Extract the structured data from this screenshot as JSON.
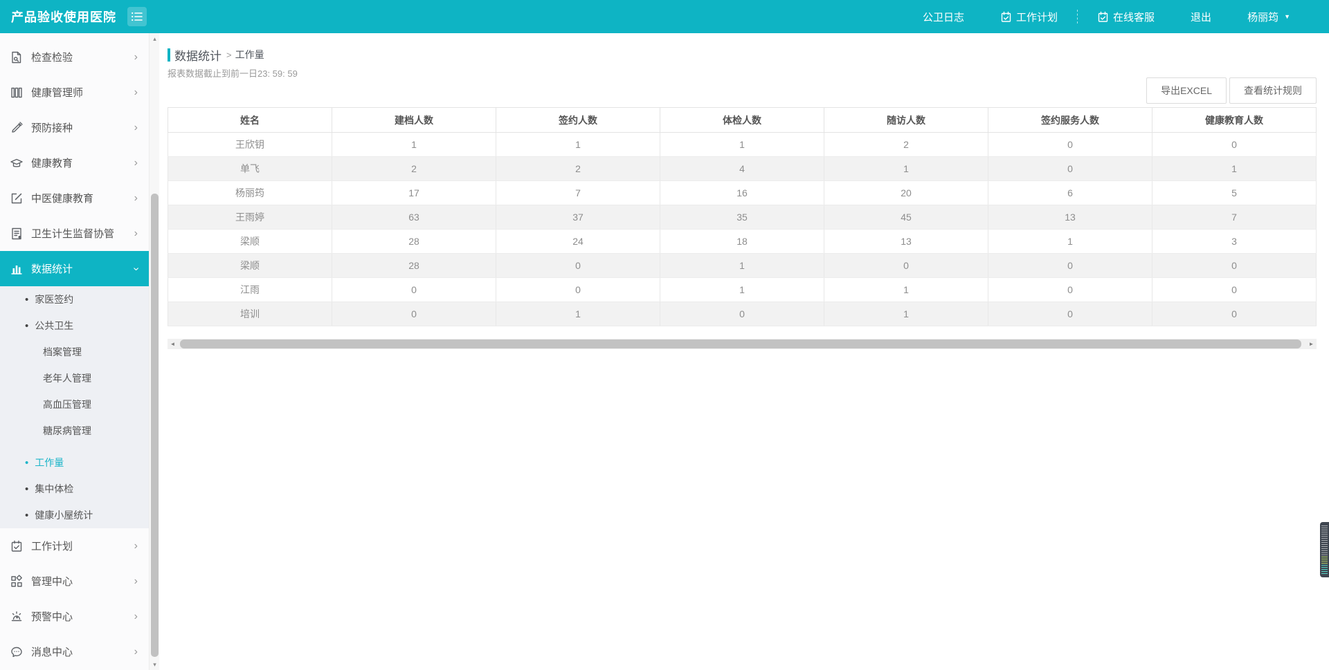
{
  "colors": {
    "accent": "#0eb4c4",
    "active_submenu_text": "#1cb5c9",
    "stripe_row": "#f2f2f2",
    "side_tab": "#3f4650"
  },
  "header": {
    "title": "产品验收使用医院",
    "menu_icon": "hamburger-list-icon",
    "nav": [
      {
        "label": "公卫日志"
      },
      {
        "label": "工作计划",
        "icon": "clipboard-check-icon"
      },
      {
        "divider": true
      },
      {
        "label": "在线客服",
        "icon": "clipboard-check-icon"
      },
      {
        "label": "退出"
      },
      {
        "label": "杨丽筠",
        "caret": "caret-down-icon"
      }
    ]
  },
  "sidebar": {
    "items": [
      {
        "type": "main",
        "label": "检查检验",
        "icon": "file-search-icon",
        "chevron": "right"
      },
      {
        "type": "main",
        "label": "健康管理师",
        "icon": "books-icon",
        "chevron": "right"
      },
      {
        "type": "main",
        "label": "预防接种",
        "icon": "syringe-icon",
        "chevron": "right"
      },
      {
        "type": "main",
        "label": "健康教育",
        "icon": "graduation-cap-icon",
        "chevron": "right"
      },
      {
        "type": "main",
        "label": "中医健康教育",
        "icon": "edit-square-icon",
        "chevron": "right"
      },
      {
        "type": "main",
        "label": "卫生计生监督协管",
        "icon": "report-doc-icon",
        "chevron": "right"
      },
      {
        "type": "main",
        "label": "数据统计",
        "icon": "bar-chart-icon",
        "chevron": "down",
        "active": true
      },
      {
        "type": "sub",
        "label": "家医签约",
        "bullet": "•"
      },
      {
        "type": "sub",
        "label": "公共卫生",
        "bullet": "•"
      },
      {
        "type": "subsub",
        "label": "档案管理"
      },
      {
        "type": "subsub",
        "label": "老年人管理"
      },
      {
        "type": "subsub",
        "label": "高血压管理"
      },
      {
        "type": "subsub",
        "label": "糖尿病管理"
      },
      {
        "type": "sub",
        "label": "工作量",
        "bullet": "•",
        "active": true,
        "gapTop": true
      },
      {
        "type": "sub",
        "label": "集中体检",
        "bullet": "•"
      },
      {
        "type": "sub",
        "label": "健康小屋统计",
        "bullet": "•"
      },
      {
        "type": "main",
        "label": "工作计划",
        "icon": "calendar-check-icon",
        "chevron": "right"
      },
      {
        "type": "main",
        "label": "管理中心",
        "icon": "grid-icon",
        "chevron": "right"
      },
      {
        "type": "main",
        "label": "预警中心",
        "icon": "alarm-icon",
        "chevron": "right"
      },
      {
        "type": "main",
        "label": "消息中心",
        "icon": "chat-dots-icon",
        "chevron": "right"
      }
    ]
  },
  "breadcrumb": {
    "section": "数据统计",
    "separator": ">",
    "page": "工作量"
  },
  "subtitle": "报表数据截止到前一日23: 59: 59",
  "toolbar": {
    "export_label": "导出EXCEL",
    "rules_label": "查看统计规则"
  },
  "table": {
    "columns": [
      "姓名",
      "建档人数",
      "签约人数",
      "体检人数",
      "随访人数",
      "签约服务人数",
      "健康教育人数"
    ],
    "rows": [
      {
        "name": "王欣钥",
        "values": [
          1,
          1,
          1,
          2,
          0,
          0
        ]
      },
      {
        "name": "单飞",
        "values": [
          2,
          2,
          4,
          1,
          0,
          1
        ]
      },
      {
        "name": "杨丽筠",
        "values": [
          17,
          7,
          16,
          20,
          6,
          5
        ]
      },
      {
        "name": "王雨婷",
        "values": [
          63,
          37,
          35,
          45,
          13,
          7
        ]
      },
      {
        "name": "梁顺",
        "values": [
          28,
          24,
          18,
          13,
          1,
          3
        ]
      },
      {
        "name": "梁顺",
        "values": [
          28,
          0,
          1,
          0,
          0,
          0
        ]
      },
      {
        "name": "江雨",
        "values": [
          0,
          0,
          1,
          1,
          0,
          0
        ]
      },
      {
        "name": "培训",
        "values": [
          0,
          1,
          0,
          1,
          0,
          0
        ]
      }
    ]
  },
  "scrollbars": {
    "up_arrow": "▴",
    "down_arrow": "▾",
    "left_arrow": "◄",
    "right_arrow": "►"
  }
}
